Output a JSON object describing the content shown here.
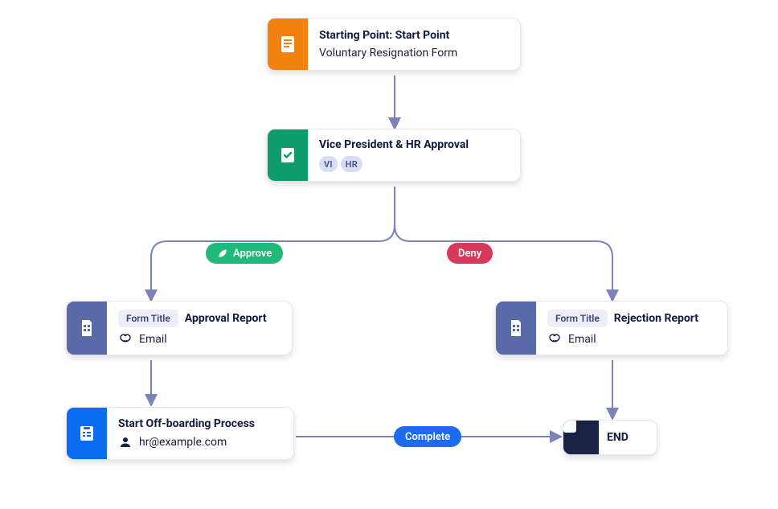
{
  "nodes": {
    "start": {
      "label": "Starting Point: Start Point",
      "subtitle": "Voluntary Resignation Form"
    },
    "approval": {
      "title": "Vice President & HR Approval",
      "chips": [
        "VI",
        "HR"
      ]
    },
    "approval_report": {
      "tag_label": "Form Title",
      "tag_value": "Approval Report",
      "link_label": "Email"
    },
    "rejection_report": {
      "tag_label": "Form Title",
      "tag_value": "Rejection Report",
      "link_label": "Email"
    },
    "offboard": {
      "title": "Start Off-boarding Process",
      "assignee": "hr@example.com"
    },
    "end": {
      "label": "END"
    }
  },
  "edges": {
    "approve": "Approve",
    "deny": "Deny",
    "complete": "Complete"
  }
}
